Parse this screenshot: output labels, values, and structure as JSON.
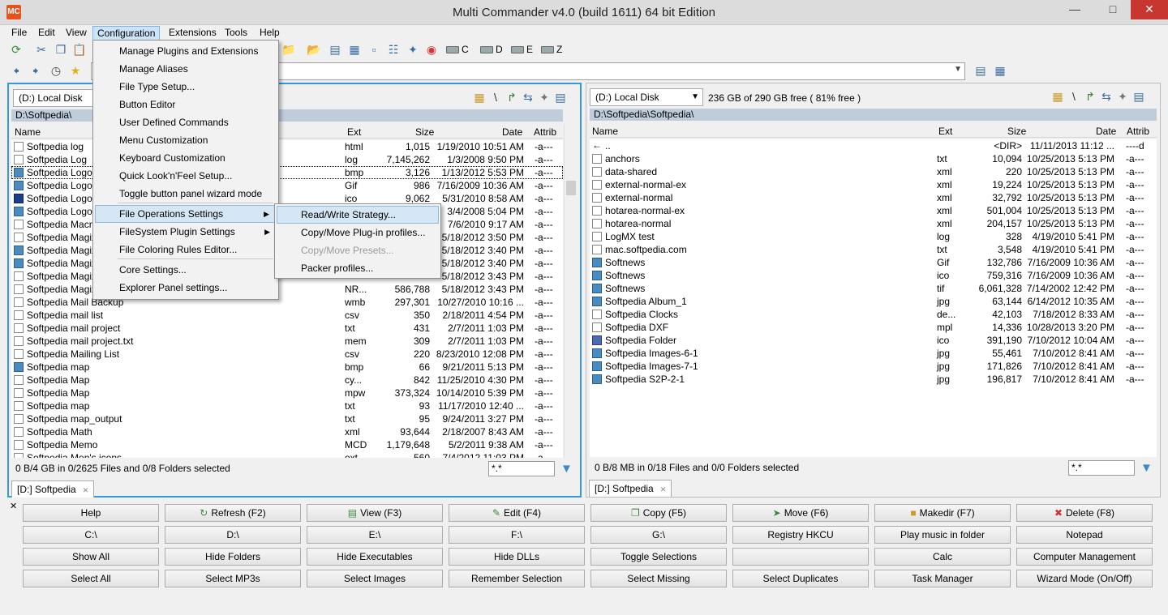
{
  "window": {
    "title": "Multi Commander v4.0 (build 1611) 64 bit Edition",
    "app_icon": "MC"
  },
  "menu": [
    "File",
    "Edit",
    "View",
    "Configuration",
    "Extensions",
    "Tools",
    "Help"
  ],
  "drives": [
    "C",
    "D",
    "E",
    "Z"
  ],
  "config_menu": {
    "items": [
      "Manage Plugins and Extensions",
      "Manage Aliases",
      "File Type Setup...",
      "Button Editor",
      "User Defined Commands",
      "Menu Customization",
      "Keyboard Customization",
      "Quick Look'n'Feel Setup...",
      "Toggle button panel wizard mode",
      "File Operations Settings",
      "FileSystem Plugin Settings",
      "File Coloring Rules Editor...",
      "Core Settings...",
      "Explorer Panel settings..."
    ]
  },
  "fileops_submenu": {
    "items": [
      "Read/Write Strategy...",
      "Copy/Move Plug-in profiles...",
      "Copy/Move Presets...",
      "Packer profiles..."
    ]
  },
  "left_panel": {
    "drive": "(D:) Local Disk",
    "path": "D:\\Softpedia\\",
    "columns": [
      "Name",
      "Ext",
      "Size",
      "Date",
      "Attrib"
    ],
    "rows": [
      {
        "name": "Softpedia log",
        "ext": "html",
        "size": "1,015",
        "date": "1/19/2010 10:51 AM",
        "attr": "-a---",
        "icon": "doc"
      },
      {
        "name": "Softpedia Log",
        "ext": "log",
        "size": "7,145,262",
        "date": "1/3/2008 9:50 PM",
        "attr": "-a---",
        "icon": "doc"
      },
      {
        "name": "Softpedia Logo",
        "ext": "bmp",
        "size": "3,126",
        "date": "1/13/2012 5:53 PM",
        "attr": "-a---",
        "icon": "img"
      },
      {
        "name": "Softpedia Logo",
        "ext": "Gif",
        "size": "986",
        "date": "7/16/2009 10:36 AM",
        "attr": "-a---",
        "icon": "img"
      },
      {
        "name": "Softpedia Logo",
        "ext": "ico",
        "size": "9,062",
        "date": "5/31/2010 8:58 AM",
        "attr": "-a---",
        "icon": "s"
      },
      {
        "name": "Softpedia Logo",
        "ext": "",
        "size": "",
        "date": "3/4/2008 5:04 PM",
        "attr": "-a---",
        "icon": "img"
      },
      {
        "name": "Softpedia Macro",
        "ext": "",
        "size": "",
        "date": "7/6/2010 9:17 AM",
        "attr": "-a---",
        "icon": "doc"
      },
      {
        "name": "Softpedia Magix",
        "ext": "",
        "size": "",
        "date": "5/18/2012 3:50 PM",
        "attr": "-a---",
        "icon": "doc"
      },
      {
        "name": "Softpedia Magix_",
        "ext": "",
        "size": "",
        "date": "5/18/2012 3:40 PM",
        "attr": "-a---",
        "icon": "img"
      },
      {
        "name": "Softpedia Magix_",
        "ext": "",
        "size": "",
        "date": "5/18/2012 3:40 PM",
        "attr": "-a---",
        "icon": "img"
      },
      {
        "name": "Softpedia Magix_",
        "ext": "",
        "size": "",
        "date": "5/18/2012 3:43 PM",
        "attr": "-a---",
        "icon": "doc"
      },
      {
        "name": "Softpedia Magix_",
        "ext": "NR...",
        "size": "586,788",
        "date": "5/18/2012 3:43 PM",
        "attr": "-a---",
        "icon": "doc"
      },
      {
        "name": "Softpedia Mail Backup",
        "ext": "wmb",
        "size": "297,301",
        "date": "10/27/2010 10:16 ...",
        "attr": "-a---",
        "icon": "doc"
      },
      {
        "name": "Softpedia mail list",
        "ext": "csv",
        "size": "350",
        "date": "2/18/2011 4:54 PM",
        "attr": "-a---",
        "icon": "doc"
      },
      {
        "name": "Softpedia mail project",
        "ext": "txt",
        "size": "431",
        "date": "2/7/2011 1:03 PM",
        "attr": "-a---",
        "icon": "doc"
      },
      {
        "name": "Softpedia mail project.txt",
        "ext": "mem",
        "size": "309",
        "date": "2/7/2011 1:03 PM",
        "attr": "-a---",
        "icon": "doc"
      },
      {
        "name": "Softpedia Mailing List",
        "ext": "csv",
        "size": "220",
        "date": "8/23/2010 12:08 PM",
        "attr": "-a---",
        "icon": "doc"
      },
      {
        "name": "Softpedia map",
        "ext": "bmp",
        "size": "66",
        "date": "9/21/2011 5:13 PM",
        "attr": "-a---",
        "icon": "img"
      },
      {
        "name": "Softpedia Map",
        "ext": "cy...",
        "size": "842",
        "date": "11/25/2010 4:30 PM",
        "attr": "-a---",
        "icon": "doc"
      },
      {
        "name": "Softpedia Map",
        "ext": "mpw",
        "size": "373,324",
        "date": "10/14/2010 5:39 PM",
        "attr": "-a---",
        "icon": "doc"
      },
      {
        "name": "Softpedia map",
        "ext": "txt",
        "size": "93",
        "date": "11/17/2010 12:40 ...",
        "attr": "-a---",
        "icon": "doc"
      },
      {
        "name": "Softpedia map_output",
        "ext": "txt",
        "size": "95",
        "date": "9/24/2011 3:27 PM",
        "attr": "-a---",
        "icon": "doc"
      },
      {
        "name": "Softpedia Math",
        "ext": "xml",
        "size": "93,644",
        "date": "2/18/2007 8:43 AM",
        "attr": "-a---",
        "icon": "doc"
      },
      {
        "name": "Softpedia Memo",
        "ext": "MCD",
        "size": "1,179,648",
        "date": "5/2/2011 9:38 AM",
        "attr": "-a---",
        "icon": "doc"
      },
      {
        "name": "Softpedia Men's icons",
        "ext": "ext",
        "size": "560",
        "date": "7/4/2012 11:03 PM",
        "attr": "-a---",
        "icon": "doc"
      }
    ],
    "status": "0 B/4 GB in 0/2625 Files and 0/8 Folders selected",
    "filter": "*.*",
    "tab": "[D:] Softpedia"
  },
  "right_panel": {
    "drive": "(D:) Local Disk",
    "free": "236 GB of 290 GB free ( 81% free )",
    "path": "D:\\Softpedia\\Softpedia\\",
    "columns": [
      "Name",
      "Ext",
      "Size",
      "Date",
      "Attrib"
    ],
    "rows": [
      {
        "name": "..",
        "ext": "",
        "size": "<DIR>",
        "date": "11/11/2013 11:12 ...",
        "attr": "----d",
        "icon": "up"
      },
      {
        "name": "anchors",
        "ext": "txt",
        "size": "10,094",
        "date": "10/25/2013 5:13 PM",
        "attr": "-a---",
        "icon": "doc"
      },
      {
        "name": "data-shared",
        "ext": "xml",
        "size": "220",
        "date": "10/25/2013 5:13 PM",
        "attr": "-a---",
        "icon": "doc"
      },
      {
        "name": "external-normal-ex",
        "ext": "xml",
        "size": "19,224",
        "date": "10/25/2013 5:13 PM",
        "attr": "-a---",
        "icon": "doc"
      },
      {
        "name": "external-normal",
        "ext": "xml",
        "size": "32,792",
        "date": "10/25/2013 5:13 PM",
        "attr": "-a---",
        "icon": "doc"
      },
      {
        "name": "hotarea-normal-ex",
        "ext": "xml",
        "size": "501,004",
        "date": "10/25/2013 5:13 PM",
        "attr": "-a---",
        "icon": "doc"
      },
      {
        "name": "hotarea-normal",
        "ext": "xml",
        "size": "204,157",
        "date": "10/25/2013 5:13 PM",
        "attr": "-a---",
        "icon": "doc"
      },
      {
        "name": "LogMX test",
        "ext": "log",
        "size": "328",
        "date": "4/19/2010 5:41 PM",
        "attr": "-a---",
        "icon": "doc"
      },
      {
        "name": "mac.softpedia.com",
        "ext": "txt",
        "size": "3,548",
        "date": "4/19/2010 5:41 PM",
        "attr": "-a---",
        "icon": "doc"
      },
      {
        "name": "Softnews",
        "ext": "Gif",
        "size": "132,786",
        "date": "7/16/2009 10:36 AM",
        "attr": "-a---",
        "icon": "img"
      },
      {
        "name": "Softnews",
        "ext": "ico",
        "size": "759,316",
        "date": "7/16/2009 10:36 AM",
        "attr": "-a---",
        "icon": "img"
      },
      {
        "name": "Softnews",
        "ext": "tif",
        "size": "6,061,328",
        "date": "7/14/2002 12:42 PM",
        "attr": "-a---",
        "icon": "img"
      },
      {
        "name": "Softpedia Album_1",
        "ext": "jpg",
        "size": "63,144",
        "date": "6/14/2012 10:35 AM",
        "attr": "-a---",
        "icon": "img"
      },
      {
        "name": "Softpedia Clocks",
        "ext": "de...",
        "size": "42,103",
        "date": "7/18/2012 8:33 AM",
        "attr": "-a---",
        "icon": "doc"
      },
      {
        "name": "Softpedia DXF",
        "ext": "mpl",
        "size": "14,336",
        "date": "10/28/2013 3:20 PM",
        "attr": "-a---",
        "icon": "doc"
      },
      {
        "name": "Softpedia Folder",
        "ext": "ico",
        "size": "391,190",
        "date": "7/10/2012 10:04 AM",
        "attr": "-a---",
        "icon": "folder"
      },
      {
        "name": "Softpedia Images-6-1",
        "ext": "jpg",
        "size": "55,461",
        "date": "7/10/2012 8:41 AM",
        "attr": "-a---",
        "icon": "img"
      },
      {
        "name": "Softpedia Images-7-1",
        "ext": "jpg",
        "size": "171,826",
        "date": "7/10/2012 8:41 AM",
        "attr": "-a---",
        "icon": "img"
      },
      {
        "name": "Softpedia S2P-2-1",
        "ext": "jpg",
        "size": "196,817",
        "date": "7/10/2012 8:41 AM",
        "attr": "-a---",
        "icon": "img"
      }
    ],
    "status": "0 B/8 MB in 0/18 Files and 0/0 Folders selected",
    "filter": "*.*",
    "tab": "[D:] Softpedia"
  },
  "buttons": [
    [
      "Help",
      "Refresh (F2)",
      "View (F3)",
      "Edit (F4)",
      "Copy (F5)",
      "Move (F6)",
      "Makedir (F7)",
      "Delete (F8)"
    ],
    [
      "C:\\",
      "D:\\",
      "E:\\",
      "F:\\",
      "G:\\",
      "Registry HKCU",
      "Play music in folder",
      "Notepad"
    ],
    [
      "Show All",
      "Hide Folders",
      "Hide Executables",
      "Hide DLLs",
      "Toggle Selections",
      "",
      "Calc",
      "Computer Management"
    ],
    [
      "Select All",
      "Select MP3s",
      "Select Images",
      "Remember Selection",
      "Select Missing",
      "Select Duplicates",
      "Task Manager",
      "Wizard Mode (On/Off)"
    ]
  ]
}
